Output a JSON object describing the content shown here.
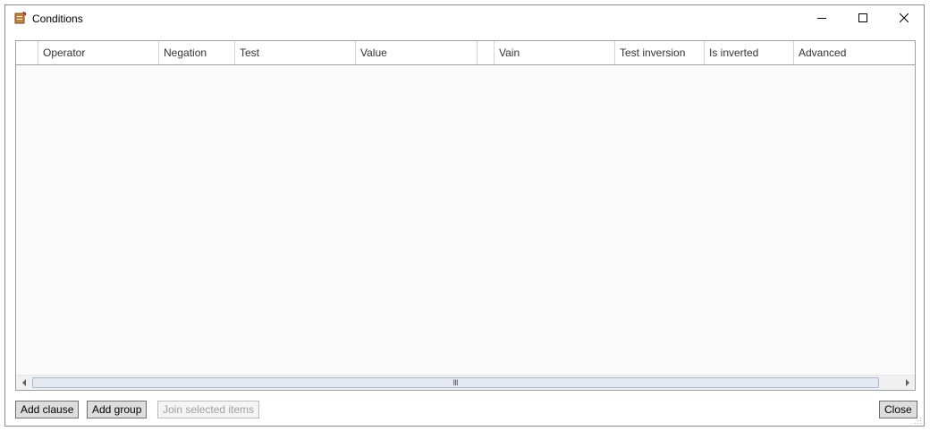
{
  "window": {
    "title": "Conditions",
    "controls": {
      "minimize": "minimize",
      "maximize": "maximize",
      "close": "close"
    }
  },
  "grid": {
    "columns": [
      {
        "key": "selector",
        "label": ""
      },
      {
        "key": "operator",
        "label": "Operator"
      },
      {
        "key": "negation",
        "label": "Negation"
      },
      {
        "key": "test",
        "label": "Test"
      },
      {
        "key": "value",
        "label": "Value"
      },
      {
        "key": "blank",
        "label": ""
      },
      {
        "key": "vain",
        "label": "Vain"
      },
      {
        "key": "test_inversion",
        "label": "Test inversion"
      },
      {
        "key": "is_inverted",
        "label": "Is inverted"
      },
      {
        "key": "advanced",
        "label": "Advanced"
      }
    ],
    "rows": [],
    "scroll_thumb_glyph": "Ⅲ"
  },
  "buttons": {
    "add_clause": "Add clause",
    "add_group": "Add group",
    "join_selected": "Join selected items",
    "close": "Close"
  },
  "colors": {
    "grid_background": "#fafafa",
    "header_background": "#ffffff",
    "button_background": "#dddddd",
    "disabled_text": "#a0a0a0",
    "scroll_thumb": "#e4e9f2"
  }
}
